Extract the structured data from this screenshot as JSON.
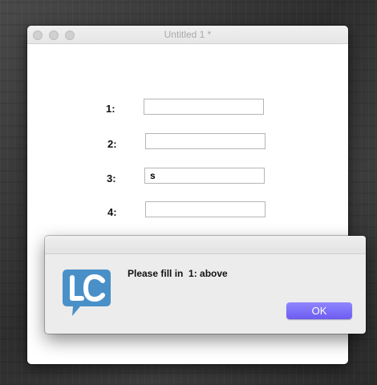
{
  "window": {
    "title": "Untitled 1 *"
  },
  "form": {
    "fields": [
      {
        "label": "1:",
        "value": ""
      },
      {
        "label": "2:",
        "value": ""
      },
      {
        "label": "3:",
        "value": "s"
      },
      {
        "label": "4:",
        "value": ""
      }
    ]
  },
  "dialog": {
    "message": "Please fill in  1: above",
    "ok_label": "OK",
    "icon": "livecode-logo-icon"
  },
  "colors": {
    "ok_button": "#7766f8",
    "logo": "#4a90c8"
  }
}
